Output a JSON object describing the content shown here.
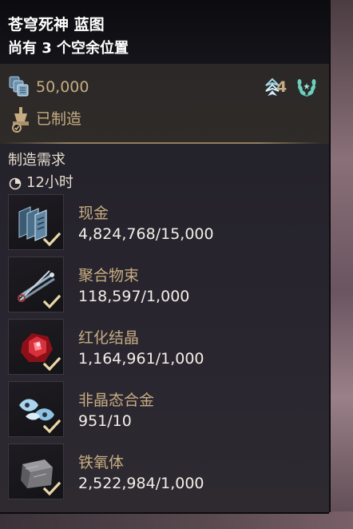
{
  "header": {
    "title": "苍穹死神 蓝图",
    "subtitle": "尚有 3 个空余位置"
  },
  "info": {
    "credits_value": "50,000",
    "credits_icon": "credits-icon",
    "mastery_rank": "4",
    "mastery_icon": "mastery-rank-icon",
    "wreath_icon": "laurel-wreath-icon",
    "crafted_text": "已制造",
    "crafted_icon": "foundry-icon"
  },
  "requirements": {
    "label": "制造需求",
    "time_icon": "clock-icon",
    "time_text": "12小时",
    "items": [
      {
        "name": "现金",
        "count": "4,824,768/15,000",
        "icon": "credits-stack-icon",
        "met": true
      },
      {
        "name": "聚合物束",
        "count": "118,597/1,000",
        "icon": "polymer-bundle-icon",
        "met": true
      },
      {
        "name": "红化结晶",
        "count": "1,164,961/1,000",
        "icon": "rubedo-icon",
        "met": true
      },
      {
        "name": "非晶态合金",
        "count": "951/10",
        "icon": "morphics-icon",
        "met": true
      },
      {
        "name": "铁氧体",
        "count": "2,522,984/1,000",
        "icon": "ferrite-icon",
        "met": true
      }
    ]
  },
  "colors": {
    "gold": "#c6ac82",
    "white": "#f2efe8",
    "check": "#e9d7a6",
    "header_bg": "#0c0c0f",
    "panel_bg": "#24222a"
  }
}
